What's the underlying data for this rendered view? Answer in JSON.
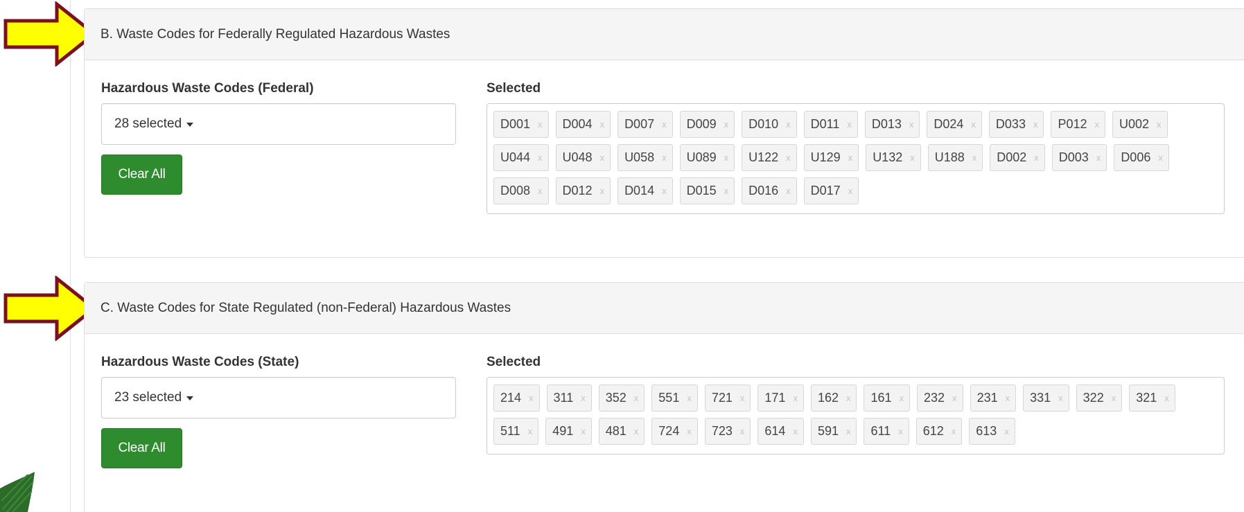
{
  "section_b": {
    "title": "B. Waste Codes for Federally Regulated Hazardous Wastes",
    "dropdown_label": "Hazardous Waste Codes (Federal)",
    "dropdown_value": "28 selected",
    "clear_label": "Clear All",
    "selected_label": "Selected",
    "codes": [
      "D001",
      "D004",
      "D007",
      "D009",
      "D010",
      "D011",
      "D013",
      "D024",
      "D033",
      "P012",
      "U002",
      "U044",
      "U048",
      "U058",
      "U089",
      "U122",
      "U129",
      "U132",
      "U188",
      "D002",
      "D003",
      "D006",
      "D008",
      "D012",
      "D014",
      "D015",
      "D016",
      "D017"
    ]
  },
  "section_c": {
    "title": "C. Waste Codes for State Regulated (non-Federal) Hazardous Wastes",
    "dropdown_label": "Hazardous Waste Codes (State)",
    "dropdown_value": "23 selected",
    "clear_label": "Clear All",
    "selected_label": "Selected",
    "codes": [
      "214",
      "311",
      "352",
      "551",
      "721",
      "171",
      "162",
      "161",
      "232",
      "231",
      "331",
      "322",
      "321",
      "511",
      "491",
      "481",
      "724",
      "723",
      "614",
      "591",
      "611",
      "612",
      "613"
    ]
  },
  "tag_remove_glyph": "x",
  "colors": {
    "arrow_fill": "#ffff00",
    "arrow_stroke": "#7b1020",
    "button_green": "#2e8b2e"
  }
}
